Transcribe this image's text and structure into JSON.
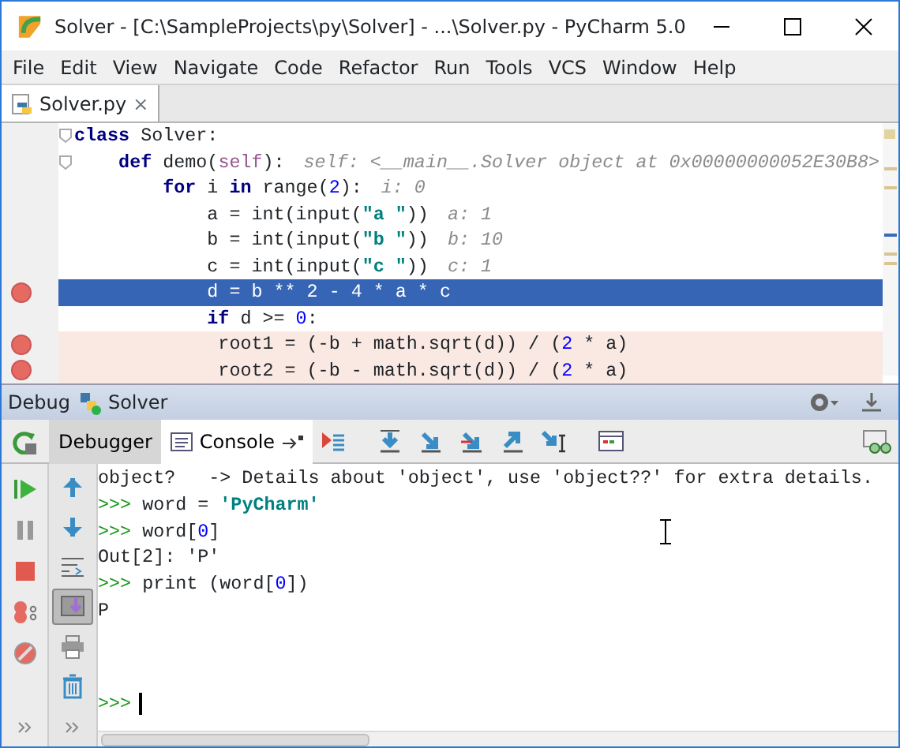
{
  "window": {
    "title": "Solver - [C:\\SampleProjects\\py\\Solver] - ...\\Solver.py - PyCharm 5.0"
  },
  "menu": [
    {
      "label": "File"
    },
    {
      "label": "Edit"
    },
    {
      "label": "View"
    },
    {
      "label": "Navigate"
    },
    {
      "label": "Code"
    },
    {
      "label": "Refactor"
    },
    {
      "label": "Run"
    },
    {
      "label": "Tools"
    },
    {
      "label": "VCS"
    },
    {
      "label": "Window"
    },
    {
      "label": "Help"
    }
  ],
  "editor_tabs": [
    {
      "label": "Solver.py",
      "close": "×",
      "selected": true
    }
  ],
  "code_lines": [
    {
      "breakpoint": false,
      "current": false,
      "fold": true,
      "segments": [
        {
          "kind": "kw",
          "text": "class"
        },
        {
          "kind": "plain",
          "text": " Solver:"
        }
      ]
    },
    {
      "breakpoint": false,
      "current": false,
      "fold": true,
      "segments": [
        {
          "kind": "kw",
          "text": "    def"
        },
        {
          "kind": "plain",
          "text": " demo("
        },
        {
          "kind": "self",
          "text": "self"
        },
        {
          "kind": "plain",
          "text": "):"
        }
      ],
      "hint": "self: <__main__.Solver object at 0x00000000052E30B8>"
    },
    {
      "breakpoint": false,
      "current": false,
      "fold": false,
      "segments": [
        {
          "kind": "kw",
          "text": "        for"
        },
        {
          "kind": "plain",
          "text": " i "
        },
        {
          "kind": "kw",
          "text": "in"
        },
        {
          "kind": "plain",
          "text": " range("
        },
        {
          "kind": "num",
          "text": "2"
        },
        {
          "kind": "plain",
          "text": "):"
        }
      ],
      "hint": "i: 0"
    },
    {
      "breakpoint": false,
      "current": false,
      "fold": false,
      "segments": [
        {
          "kind": "plain",
          "text": "            a = int(input("
        },
        {
          "kind": "str",
          "text": "\"a \""
        },
        {
          "kind": "plain",
          "text": "))"
        }
      ],
      "hint": "a: 1"
    },
    {
      "breakpoint": false,
      "current": false,
      "fold": false,
      "segments": [
        {
          "kind": "plain",
          "text": "            b = int(input("
        },
        {
          "kind": "str",
          "text": "\"b \""
        },
        {
          "kind": "plain",
          "text": "))"
        }
      ],
      "hint": "b: 10"
    },
    {
      "breakpoint": false,
      "current": false,
      "fold": false,
      "segments": [
        {
          "kind": "plain",
          "text": "            c = int(input("
        },
        {
          "kind": "str",
          "text": "\"c \""
        },
        {
          "kind": "plain",
          "text": "))"
        }
      ],
      "hint": "c: 1"
    },
    {
      "breakpoint": true,
      "current": true,
      "fold": false,
      "segments": [
        {
          "kind": "plain",
          "text": "            d = b ** 2 - 4 * a * c"
        }
      ]
    },
    {
      "breakpoint": false,
      "current": false,
      "fold": false,
      "segments": [
        {
          "kind": "kw",
          "text": "            if"
        },
        {
          "kind": "plain",
          "text": " d >= "
        },
        {
          "kind": "num",
          "text": "0"
        },
        {
          "kind": "plain",
          "text": ":"
        }
      ]
    },
    {
      "breakpoint": true,
      "current": false,
      "fold": false,
      "segments": [
        {
          "kind": "plain",
          "text": "             root1 = (-b + math.sqrt(d)) / ("
        },
        {
          "kind": "num",
          "text": "2"
        },
        {
          "kind": "plain",
          "text": " * a)"
        }
      ]
    },
    {
      "breakpoint": true,
      "current": false,
      "fold": false,
      "segments": [
        {
          "kind": "plain",
          "text": "             root2 = (-b - math.sqrt(d)) / ("
        },
        {
          "kind": "num",
          "text": "2"
        },
        {
          "kind": "plain",
          "text": " * a)"
        }
      ]
    }
  ],
  "debug_panel": {
    "label": "Debug",
    "config": "Solver",
    "tabs": [
      {
        "label": "Debugger",
        "selected": false
      },
      {
        "label": "Console",
        "selected": true
      }
    ],
    "console_lines": [
      [
        {
          "kind": "plain",
          "text": "object?   -> Details about 'object', use 'object??' for extra details."
        }
      ],
      [
        {
          "kind": "prompt",
          "text": ">>> "
        },
        {
          "kind": "plain",
          "text": "word = "
        },
        {
          "kind": "str",
          "text": "'PyCharm'"
        }
      ],
      [
        {
          "kind": "prompt",
          "text": ">>> "
        },
        {
          "kind": "plain",
          "text": "word["
        },
        {
          "kind": "num",
          "text": "0"
        },
        {
          "kind": "plain",
          "text": "]"
        }
      ],
      [
        {
          "kind": "plain",
          "text": "Out[2]: 'P'"
        }
      ],
      [
        {
          "kind": "prompt",
          "text": ">>> "
        },
        {
          "kind": "plain",
          "text": "print (word["
        },
        {
          "kind": "num",
          "text": "0"
        },
        {
          "kind": "plain",
          "text": "])"
        }
      ],
      [
        {
          "kind": "plain",
          "text": "P"
        }
      ]
    ],
    "input_prompt": ">>>",
    "side_tools": [
      {
        "kind": "up",
        "on": false
      },
      {
        "kind": "down",
        "on": false
      },
      {
        "kind": "wrap",
        "on": false
      },
      {
        "kind": "scroll-end",
        "on": true
      },
      {
        "kind": "print",
        "on": false
      },
      {
        "kind": "trash",
        "on": false
      }
    ]
  }
}
